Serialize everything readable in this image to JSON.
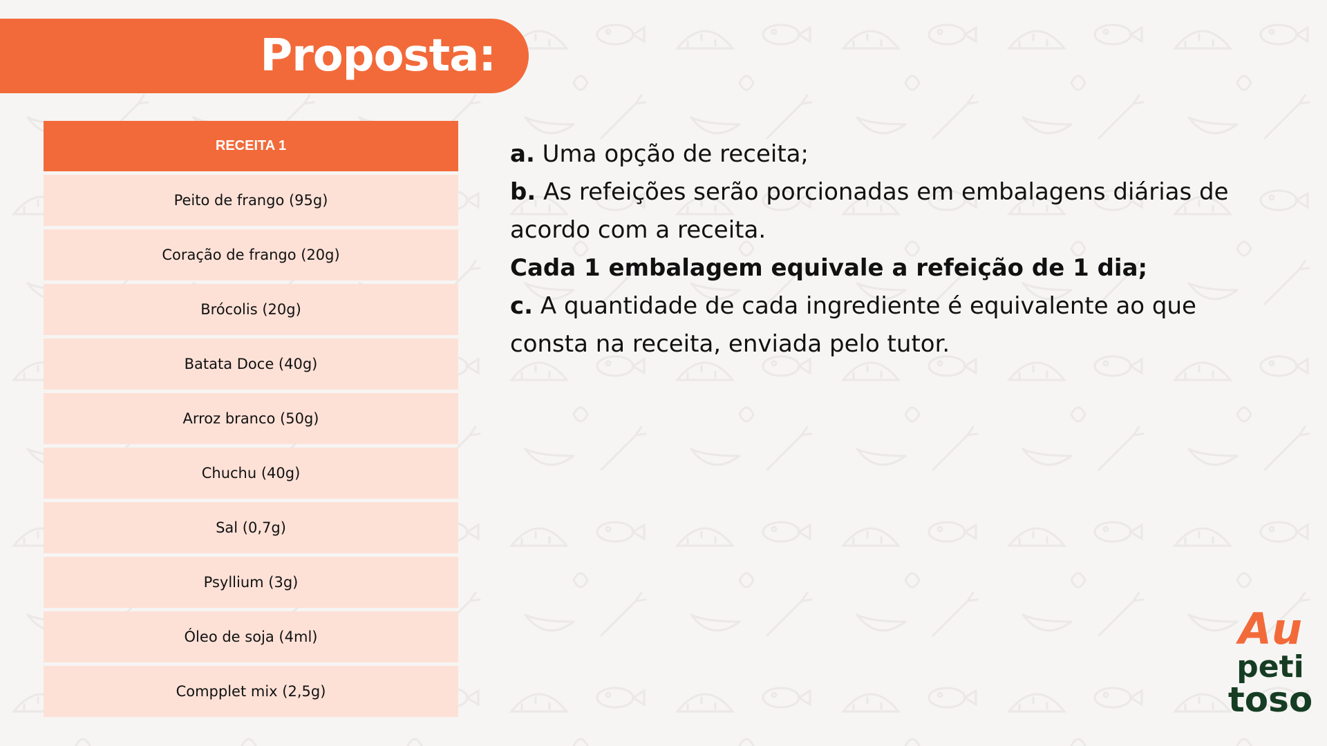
{
  "header": {
    "title": "Proposta:"
  },
  "table": {
    "header": "RECEITA 1",
    "rows": [
      "Peito de frango (95g)",
      "Coração de frango (20g)",
      "Brócolis (20g)",
      "Batata Doce (40g)",
      "Arroz branco (50g)",
      "Chuchu (40g)",
      "Sal (0,7g)",
      "Psyllium (3g)",
      "Óleo de soja (4ml)",
      "Compplet mix (2,5g)"
    ]
  },
  "description": {
    "a_label": "a.",
    "a_text": " Uma opção de receita;",
    "b_label": "b.",
    "b_text": " As refeições serão porcionadas em embalagens diárias de acordo com a receita.",
    "bold_note": "Cada 1 embalagem equivale a refeição de 1 dia;",
    "c_label": "c.",
    "c_text": " A quantidade de cada ingrediente é equivalente ao que consta na receita, enviada pelo tutor."
  },
  "logo": {
    "line1": "Au",
    "line2": "peti",
    "line3": "toso"
  },
  "colors": {
    "accent": "#f26a3a",
    "row_bg": "#fde1d7",
    "logo_green": "#163d23",
    "background": "#f6f5f4"
  }
}
